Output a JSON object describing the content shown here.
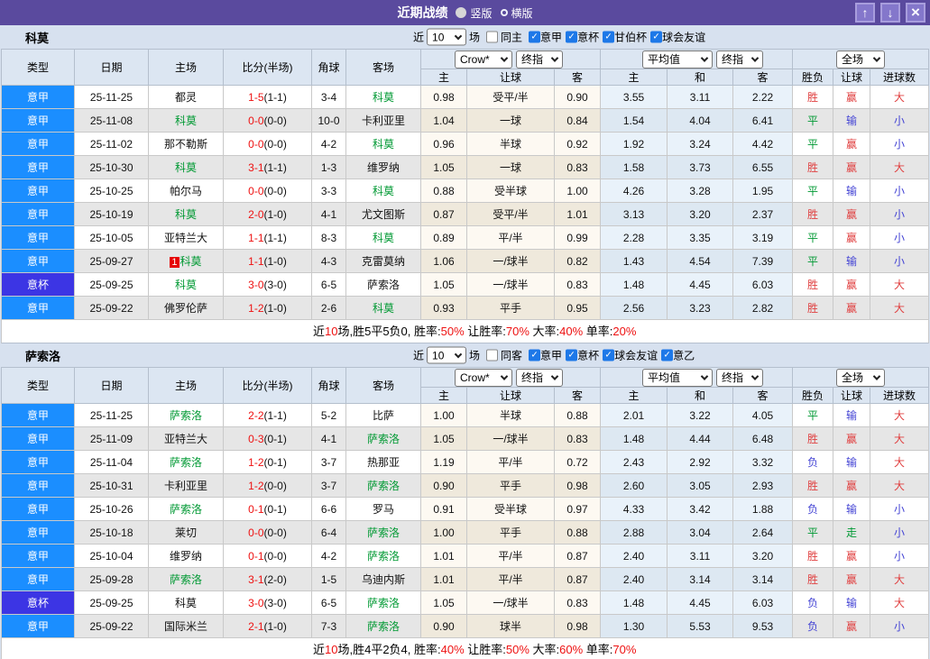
{
  "icons": {
    "check": "✓",
    "up_arrow": "↑",
    "down_arrow": "↓",
    "close": "×"
  },
  "palette": {
    "titlebar": "#5a4a9e",
    "titlebar_button": "#8477cb",
    "serie_a_badge": "#1b8eff",
    "cup_badge": "#3c35e4",
    "team_highlight": "#009933",
    "score_red": "#ee1111",
    "result_red": "#e04040",
    "result_green": "#009933",
    "result_blue": "#4444d4",
    "checkbox_blue": "#1d78e8",
    "section_bg": "#d7e1ef",
    "header_cell_bg": "#dce6f2"
  },
  "titlebar": {
    "title": "近期战绩",
    "radios": [
      {
        "label": "竖版",
        "selected": true
      },
      {
        "label": "横版",
        "selected": false
      }
    ]
  },
  "columns": {
    "left": [
      "类型",
      "日期",
      "主场",
      "比分(半场)",
      "角球",
      "客场"
    ],
    "sub": [
      "主",
      "让球",
      "客",
      "主",
      "和",
      "客",
      "胜负",
      "让球",
      "进球数"
    ]
  },
  "sections": [
    {
      "team": "科莫",
      "filters": {
        "near_label": "近",
        "count": "10",
        "matches_label": "场",
        "same": {
          "label": "同主",
          "checked": false
        },
        "leagues": [
          {
            "label": "意甲",
            "checked": true
          },
          {
            "label": "意杯",
            "checked": true
          },
          {
            "label": "甘伯杯",
            "checked": true
          },
          {
            "label": "球会友谊",
            "checked": true
          }
        ]
      },
      "selectors": {
        "odds_company": "Crow*",
        "odds_final_1": "终指",
        "avg": "平均值",
        "odds_final_2": "终指",
        "scope": "全场"
      },
      "rows": [
        {
          "league": "意甲",
          "cup": false,
          "date": "25-11-25",
          "home": "都灵",
          "home_team": false,
          "red_card": "",
          "score": "1-5",
          "half": "(1-1)",
          "corner": "3-4",
          "away": "科莫",
          "away_team": true,
          "odds": [
            "0.98",
            "受平/半",
            "0.90"
          ],
          "avg": [
            "3.55",
            "3.11",
            "2.22"
          ],
          "res": [
            [
              "胜",
              "r"
            ],
            [
              "赢",
              "r"
            ],
            [
              "大",
              "r"
            ]
          ]
        },
        {
          "league": "意甲",
          "cup": false,
          "date": "25-11-08",
          "home": "科莫",
          "home_team": true,
          "red_card": "",
          "score": "0-0",
          "half": "(0-0)",
          "corner": "10-0",
          "away": "卡利亚里",
          "away_team": false,
          "odds": [
            "1.04",
            "一球",
            "0.84"
          ],
          "avg": [
            "1.54",
            "4.04",
            "6.41"
          ],
          "res": [
            [
              "平",
              "g"
            ],
            [
              "输",
              "b"
            ],
            [
              "小",
              "b"
            ]
          ]
        },
        {
          "league": "意甲",
          "cup": false,
          "date": "25-11-02",
          "home": "那不勒斯",
          "home_team": false,
          "red_card": "",
          "score": "0-0",
          "half": "(0-0)",
          "corner": "4-2",
          "away": "科莫",
          "away_team": true,
          "odds": [
            "0.96",
            "半球",
            "0.92"
          ],
          "avg": [
            "1.92",
            "3.24",
            "4.42"
          ],
          "res": [
            [
              "平",
              "g"
            ],
            [
              "赢",
              "r"
            ],
            [
              "小",
              "b"
            ]
          ]
        },
        {
          "league": "意甲",
          "cup": false,
          "date": "25-10-30",
          "home": "科莫",
          "home_team": true,
          "red_card": "",
          "score": "3-1",
          "half": "(1-1)",
          "corner": "1-3",
          "away": "维罗纳",
          "away_team": false,
          "odds": [
            "1.05",
            "一球",
            "0.83"
          ],
          "avg": [
            "1.58",
            "3.73",
            "6.55"
          ],
          "res": [
            [
              "胜",
              "r"
            ],
            [
              "赢",
              "r"
            ],
            [
              "大",
              "r"
            ]
          ]
        },
        {
          "league": "意甲",
          "cup": false,
          "date": "25-10-25",
          "home": "帕尔马",
          "home_team": false,
          "red_card": "",
          "score": "0-0",
          "half": "(0-0)",
          "corner": "3-3",
          "away": "科莫",
          "away_team": true,
          "odds": [
            "0.88",
            "受半球",
            "1.00"
          ],
          "avg": [
            "4.26",
            "3.28",
            "1.95"
          ],
          "res": [
            [
              "平",
              "g"
            ],
            [
              "输",
              "b"
            ],
            [
              "小",
              "b"
            ]
          ]
        },
        {
          "league": "意甲",
          "cup": false,
          "date": "25-10-19",
          "home": "科莫",
          "home_team": true,
          "red_card": "",
          "score": "2-0",
          "half": "(1-0)",
          "corner": "4-1",
          "away": "尤文图斯",
          "away_team": false,
          "odds": [
            "0.87",
            "受平/半",
            "1.01"
          ],
          "avg": [
            "3.13",
            "3.20",
            "2.37"
          ],
          "res": [
            [
              "胜",
              "r"
            ],
            [
              "赢",
              "r"
            ],
            [
              "小",
              "b"
            ]
          ]
        },
        {
          "league": "意甲",
          "cup": false,
          "date": "25-10-05",
          "home": "亚特兰大",
          "home_team": false,
          "red_card": "",
          "score": "1-1",
          "half": "(1-1)",
          "corner": "8-3",
          "away": "科莫",
          "away_team": true,
          "odds": [
            "0.89",
            "平/半",
            "0.99"
          ],
          "avg": [
            "2.28",
            "3.35",
            "3.19"
          ],
          "res": [
            [
              "平",
              "g"
            ],
            [
              "赢",
              "r"
            ],
            [
              "小",
              "b"
            ]
          ]
        },
        {
          "league": "意甲",
          "cup": false,
          "date": "25-09-27",
          "home": "科莫",
          "home_team": true,
          "red_card": "1",
          "score": "1-1",
          "half": "(1-0)",
          "corner": "4-3",
          "away": "克雷莫纳",
          "away_team": false,
          "odds": [
            "1.06",
            "一/球半",
            "0.82"
          ],
          "avg": [
            "1.43",
            "4.54",
            "7.39"
          ],
          "res": [
            [
              "平",
              "g"
            ],
            [
              "输",
              "b"
            ],
            [
              "小",
              "b"
            ]
          ]
        },
        {
          "league": "意杯",
          "cup": true,
          "date": "25-09-25",
          "home": "科莫",
          "home_team": true,
          "red_card": "",
          "score": "3-0",
          "half": "(3-0)",
          "corner": "6-5",
          "away": "萨索洛",
          "away_team": false,
          "odds": [
            "1.05",
            "一/球半",
            "0.83"
          ],
          "avg": [
            "1.48",
            "4.45",
            "6.03"
          ],
          "res": [
            [
              "胜",
              "r"
            ],
            [
              "赢",
              "r"
            ],
            [
              "大",
              "r"
            ]
          ]
        },
        {
          "league": "意甲",
          "cup": false,
          "date": "25-09-22",
          "home": "佛罗伦萨",
          "home_team": false,
          "red_card": "",
          "score": "1-2",
          "half": "(1-0)",
          "corner": "2-6",
          "away": "科莫",
          "away_team": true,
          "odds": [
            "0.93",
            "平手",
            "0.95"
          ],
          "avg": [
            "2.56",
            "3.23",
            "2.82"
          ],
          "res": [
            [
              "胜",
              "r"
            ],
            [
              "赢",
              "r"
            ],
            [
              "大",
              "r"
            ]
          ]
        }
      ],
      "summary": [
        [
          "近",
          ""
        ],
        [
          "10",
          "r"
        ],
        [
          "场,胜5平5负0, 胜率:",
          ""
        ],
        [
          "50%",
          "r"
        ],
        [
          " 让胜率:",
          ""
        ],
        [
          "70%",
          "r"
        ],
        [
          " 大率:",
          ""
        ],
        [
          "40%",
          "r"
        ],
        [
          " 单率:",
          ""
        ],
        [
          "20%",
          "r"
        ]
      ]
    },
    {
      "team": "萨索洛",
      "filters": {
        "near_label": "近",
        "count": "10",
        "matches_label": "场",
        "same": {
          "label": "同客",
          "checked": false
        },
        "leagues": [
          {
            "label": "意甲",
            "checked": true
          },
          {
            "label": "意杯",
            "checked": true
          },
          {
            "label": "球会友谊",
            "checked": true
          },
          {
            "label": "意乙",
            "checked": true
          }
        ]
      },
      "selectors": {
        "odds_company": "Crow*",
        "odds_final_1": "终指",
        "avg": "平均值",
        "odds_final_2": "终指",
        "scope": "全场"
      },
      "rows": [
        {
          "league": "意甲",
          "cup": false,
          "date": "25-11-25",
          "home": "萨索洛",
          "home_team": true,
          "red_card": "",
          "score": "2-2",
          "half": "(1-1)",
          "corner": "5-2",
          "away": "比萨",
          "away_team": false,
          "odds": [
            "1.00",
            "半球",
            "0.88"
          ],
          "avg": [
            "2.01",
            "3.22",
            "4.05"
          ],
          "res": [
            [
              "平",
              "g"
            ],
            [
              "输",
              "b"
            ],
            [
              "大",
              "r"
            ]
          ]
        },
        {
          "league": "意甲",
          "cup": false,
          "date": "25-11-09",
          "home": "亚特兰大",
          "home_team": false,
          "red_card": "",
          "score": "0-3",
          "half": "(0-1)",
          "corner": "4-1",
          "away": "萨索洛",
          "away_team": true,
          "odds": [
            "1.05",
            "一/球半",
            "0.83"
          ],
          "avg": [
            "1.48",
            "4.44",
            "6.48"
          ],
          "res": [
            [
              "胜",
              "r"
            ],
            [
              "赢",
              "r"
            ],
            [
              "大",
              "r"
            ]
          ]
        },
        {
          "league": "意甲",
          "cup": false,
          "date": "25-11-04",
          "home": "萨索洛",
          "home_team": true,
          "red_card": "",
          "score": "1-2",
          "half": "(0-1)",
          "corner": "3-7",
          "away": "热那亚",
          "away_team": false,
          "odds": [
            "1.19",
            "平/半",
            "0.72"
          ],
          "avg": [
            "2.43",
            "2.92",
            "3.32"
          ],
          "res": [
            [
              "负",
              "b"
            ],
            [
              "输",
              "b"
            ],
            [
              "大",
              "r"
            ]
          ]
        },
        {
          "league": "意甲",
          "cup": false,
          "date": "25-10-31",
          "home": "卡利亚里",
          "home_team": false,
          "red_card": "",
          "score": "1-2",
          "half": "(0-0)",
          "corner": "3-7",
          "away": "萨索洛",
          "away_team": true,
          "odds": [
            "0.90",
            "平手",
            "0.98"
          ],
          "avg": [
            "2.60",
            "3.05",
            "2.93"
          ],
          "res": [
            [
              "胜",
              "r"
            ],
            [
              "赢",
              "r"
            ],
            [
              "大",
              "r"
            ]
          ]
        },
        {
          "league": "意甲",
          "cup": false,
          "date": "25-10-26",
          "home": "萨索洛",
          "home_team": true,
          "red_card": "",
          "score": "0-1",
          "half": "(0-1)",
          "corner": "6-6",
          "away": "罗马",
          "away_team": false,
          "odds": [
            "0.91",
            "受半球",
            "0.97"
          ],
          "avg": [
            "4.33",
            "3.42",
            "1.88"
          ],
          "res": [
            [
              "负",
              "b"
            ],
            [
              "输",
              "b"
            ],
            [
              "小",
              "b"
            ]
          ]
        },
        {
          "league": "意甲",
          "cup": false,
          "date": "25-10-18",
          "home": "莱切",
          "home_team": false,
          "red_card": "",
          "score": "0-0",
          "half": "(0-0)",
          "corner": "6-4",
          "away": "萨索洛",
          "away_team": true,
          "odds": [
            "1.00",
            "平手",
            "0.88"
          ],
          "avg": [
            "2.88",
            "3.04",
            "2.64"
          ],
          "res": [
            [
              "平",
              "g"
            ],
            [
              "走",
              "g"
            ],
            [
              "小",
              "b"
            ]
          ]
        },
        {
          "league": "意甲",
          "cup": false,
          "date": "25-10-04",
          "home": "维罗纳",
          "home_team": false,
          "red_card": "",
          "score": "0-1",
          "half": "(0-0)",
          "corner": "4-2",
          "away": "萨索洛",
          "away_team": true,
          "odds": [
            "1.01",
            "平/半",
            "0.87"
          ],
          "avg": [
            "2.40",
            "3.11",
            "3.20"
          ],
          "res": [
            [
              "胜",
              "r"
            ],
            [
              "赢",
              "r"
            ],
            [
              "小",
              "b"
            ]
          ]
        },
        {
          "league": "意甲",
          "cup": false,
          "date": "25-09-28",
          "home": "萨索洛",
          "home_team": true,
          "red_card": "",
          "score": "3-1",
          "half": "(2-0)",
          "corner": "1-5",
          "away": "乌迪内斯",
          "away_team": false,
          "odds": [
            "1.01",
            "平/半",
            "0.87"
          ],
          "avg": [
            "2.40",
            "3.14",
            "3.14"
          ],
          "res": [
            [
              "胜",
              "r"
            ],
            [
              "赢",
              "r"
            ],
            [
              "大",
              "r"
            ]
          ]
        },
        {
          "league": "意杯",
          "cup": true,
          "date": "25-09-25",
          "home": "科莫",
          "home_team": false,
          "red_card": "",
          "score": "3-0",
          "half": "(3-0)",
          "corner": "6-5",
          "away": "萨索洛",
          "away_team": true,
          "odds": [
            "1.05",
            "一/球半",
            "0.83"
          ],
          "avg": [
            "1.48",
            "4.45",
            "6.03"
          ],
          "res": [
            [
              "负",
              "b"
            ],
            [
              "输",
              "b"
            ],
            [
              "大",
              "r"
            ]
          ]
        },
        {
          "league": "意甲",
          "cup": false,
          "date": "25-09-22",
          "home": "国际米兰",
          "home_team": false,
          "red_card": "",
          "score": "2-1",
          "half": "(1-0)",
          "corner": "7-3",
          "away": "萨索洛",
          "away_team": true,
          "odds": [
            "0.90",
            "球半",
            "0.98"
          ],
          "avg": [
            "1.30",
            "5.53",
            "9.53"
          ],
          "res": [
            [
              "负",
              "b"
            ],
            [
              "赢",
              "r"
            ],
            [
              "小",
              "b"
            ]
          ]
        }
      ],
      "summary": [
        [
          "近",
          ""
        ],
        [
          "10",
          "r"
        ],
        [
          "场,胜4平2负4, 胜率:",
          ""
        ],
        [
          "40%",
          "r"
        ],
        [
          " 让胜率:",
          ""
        ],
        [
          "50%",
          "r"
        ],
        [
          " 大率:",
          ""
        ],
        [
          "60%",
          "r"
        ],
        [
          " 单率:",
          ""
        ],
        [
          "70%",
          "r"
        ]
      ]
    }
  ]
}
